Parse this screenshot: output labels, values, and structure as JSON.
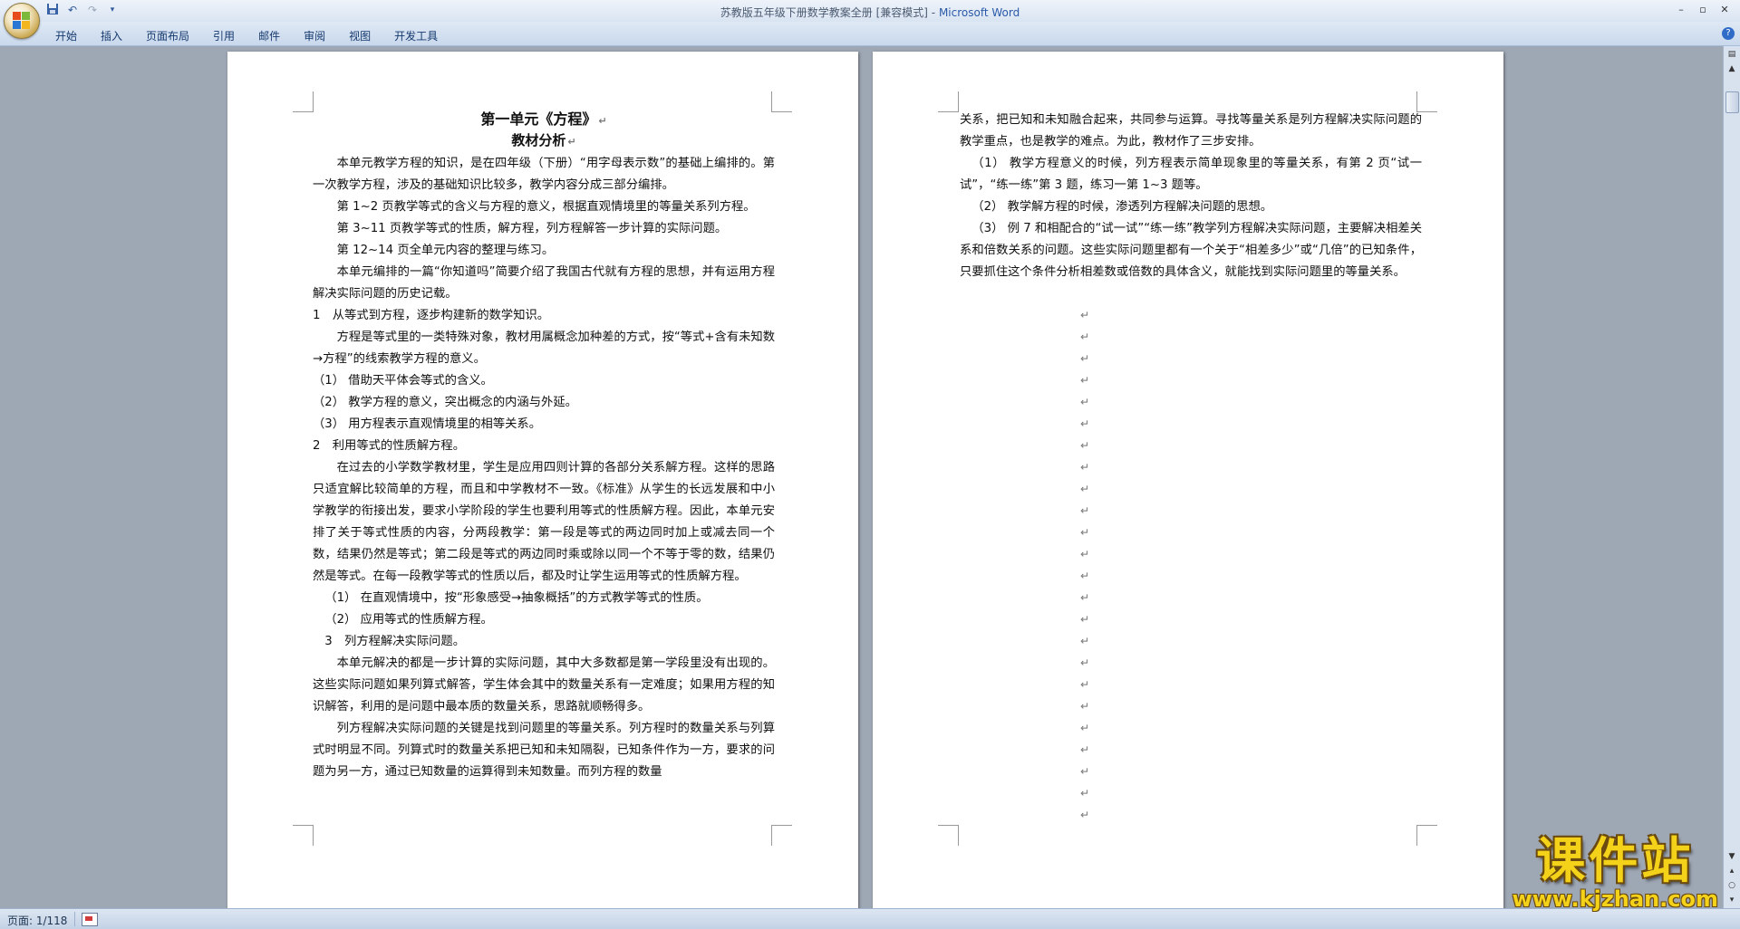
{
  "window": {
    "title": "苏教版五年级下册数学教案全册 [兼容模式]",
    "app_name": "Microsoft Word",
    "title_sep": " - ",
    "controls": [
      "minimize-icon",
      "maximize-icon",
      "close-icon"
    ]
  },
  "quick_access": {
    "icons": [
      "save-icon",
      "undo-icon",
      "redo-icon",
      "customize-icon"
    ]
  },
  "ribbon": {
    "tabs": [
      "开始",
      "插入",
      "页面布局",
      "引用",
      "邮件",
      "审阅",
      "视图",
      "开发工具"
    ]
  },
  "page1": {
    "heading": "第一单元《方程》",
    "subheading": "教材分析",
    "paragraphs": [
      "本单元教学方程的知识，是在四年级（下册）“用字母表示数”的基础上编排的。第一次教学方程，涉及的基础知识比较多，教学内容分成三部分编排。",
      "第 1~2 页教学等式的含义与方程的意义，根据直观情境里的等量关系列方程。",
      "第 3~11 页教学等式的性质，解方程，列方程解答一步计算的实际问题。",
      "第 12~14 页全单元内容的整理与练习。",
      "本单元编排的一篇“你知道吗”简要介绍了我国古代就有方程的思想，并有运用方程解决实际问题的历史记载。",
      "1　从等式到方程，逐步构建新的数学知识。",
      "方程是等式里的一类特殊对象，教材用属概念加种差的方式，按“等式+含有未知数→方程”的线索教学方程的意义。",
      "（1） 借助天平体会等式的含义。",
      "（2） 教学方程的意义，突出概念的内涵与外延。",
      "（3） 用方程表示直观情境里的相等关系。",
      "2　利用等式的性质解方程。",
      "在过去的小学数学教材里，学生是应用四则计算的各部分关系解方程。这样的思路只适宜解比较简单的方程，而且和中学教材不一致。《标准》从学生的长远发展和中小学教学的衔接出发，要求小学阶段的学生也要利用等式的性质解方程。因此，本单元安排了关于等式性质的内容，分两段教学：第一段是等式的两边同时加上或减去同一个数，结果仍然是等式；第二段是等式的两边同时乘或除以同一个不等于零的数，结果仍然是等式。在每一段教学等式的性质以后，都及时让学生运用等式的性质解方程。",
      "（1） 在直观情境中，按“形象感受→抽象概括”的方式教学等式的性质。",
      "（2） 应用等式的性质解方程。",
      "3　列方程解决实际问题。",
      "本单元解决的都是一步计算的实际问题，其中大多数都是第一学段里没有出现的。这些实际问题如果列算式解答，学生体会其中的数量关系有一定难度；如果用方程的知识解答，利用的是问题中最本质的数量关系，思路就顺畅得多。",
      "列方程解决实际问题的关键是找到问题里的等量关系。列方程时的数量关系与列算式时明显不同。列算式时的数量关系把已知和未知隔裂，已知条件作为一方，要求的问题为另一方，通过已知数量的运算得到未知数量。而列方程的数量"
    ]
  },
  "page2": {
    "paragraphs": [
      "关系，把已知和未知融合起来，共同参与运算。寻找等量关系是列方程解决实际问题的教学重点，也是教学的难点。为此，教材作了三步安排。",
      "（1） 教学方程意义的时候，列方程表示简单现象里的等量关系，有第 2 页“试一试”，“练一练”第 3 题，练习一第 1~3 题等。",
      "（2） 教学解方程的时候，渗透列方程解决问题的思想。",
      "（3） 例 7 和相配合的“试一试”“练一练”教学列方程解决实际问题，主要解决相差关系和倍数关系的问题。这些实际问题里都有一个关于“相差多少”或“几倍”的已知条件，只要抓住这个条件分析相差数或倍数的具体含义，就能找到实际问题里的等量关系。"
    ],
    "empty_paragraph_count": 24,
    "paragraph_mark": "↵"
  },
  "status": {
    "page_label": "页面: 1/118"
  },
  "watermark": {
    "main": "课件站",
    "url": "www.kjzhan.com"
  }
}
